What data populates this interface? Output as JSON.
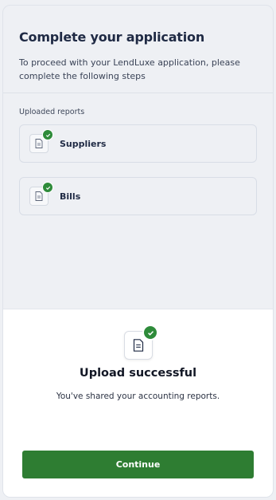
{
  "header": {
    "title": "Complete your application",
    "subtitle": "To proceed with your LendLuxe application, please complete the following steps"
  },
  "uploaded": {
    "label": "Uploaded reports",
    "items": [
      {
        "name": "Suppliers",
        "icon": "document-icon",
        "status_icon": "check-icon"
      },
      {
        "name": "Bills",
        "icon": "document-icon",
        "status_icon": "check-icon"
      }
    ]
  },
  "sheet": {
    "icon": "document-icon",
    "status_icon": "check-icon",
    "title": "Upload successful",
    "message": "You've shared your accounting reports.",
    "continue_label": "Continue"
  },
  "colors": {
    "accent_green": "#2e7d32",
    "badge_green": "#2e8b3a",
    "background": "#eef0f4",
    "title_text": "#1f2a44"
  }
}
